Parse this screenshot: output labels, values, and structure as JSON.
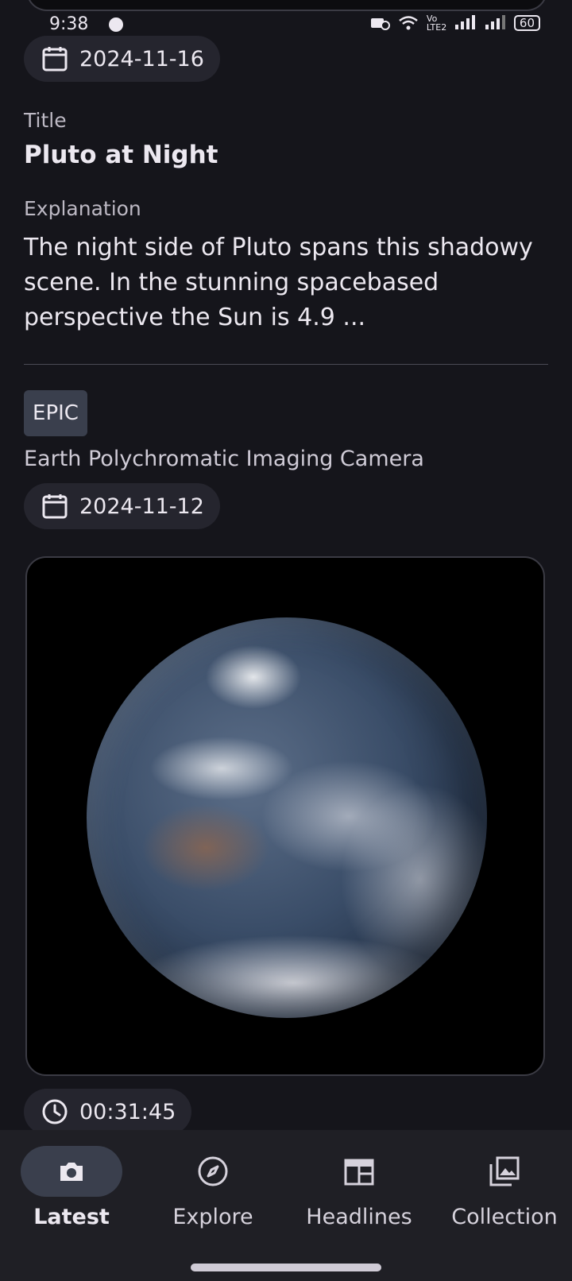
{
  "status_bar": {
    "time": "9:38",
    "network": "Vo LTE2",
    "battery": "60"
  },
  "apod": {
    "date": "2024-11-16",
    "title_label": "Title",
    "title": "Pluto at Night",
    "explanation_label": "Explanation",
    "explanation": "The night side of Pluto spans this shadowy scene. In the stunning spacebased perspective the Sun is 4.9 ..."
  },
  "epic": {
    "badge": "EPIC",
    "subtitle": "Earth Polychromatic Imaging Camera",
    "date": "2024-11-12",
    "time": "00:31:45"
  },
  "nav": {
    "items": [
      {
        "label": "Latest",
        "icon": "camera-icon",
        "active": true
      },
      {
        "label": "Explore",
        "icon": "compass-icon",
        "active": false
      },
      {
        "label": "Headlines",
        "icon": "newspaper-icon",
        "active": false
      },
      {
        "label": "Collection",
        "icon": "photo-library-icon",
        "active": false
      }
    ]
  },
  "colors": {
    "background": "#15151b",
    "chip": "#25252e",
    "badge": "#3a3f4d",
    "nav_background": "#1f1f25",
    "text": "#ece8f0"
  }
}
